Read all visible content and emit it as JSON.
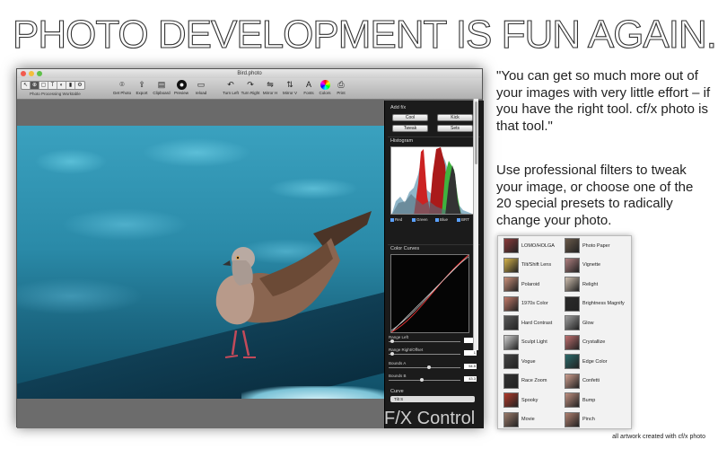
{
  "headline": "PHOTO DEVELOPMENT IS FUN AGAIN.",
  "window": {
    "title": "Bird.photo",
    "workspace_label": "Photo Processing Worktable",
    "toolbar": [
      {
        "label": "Get Photo",
        "icon": "camera-icon"
      },
      {
        "label": "Export",
        "icon": "export-icon"
      },
      {
        "label": "Clipboard",
        "icon": "clipboard-icon"
      },
      {
        "label": "Preview",
        "icon": "preview-icon"
      },
      {
        "label": "reload",
        "icon": "reload-icon"
      },
      {
        "label": "Turn Left",
        "icon": "rotate-left-icon"
      },
      {
        "label": "Turn Right",
        "icon": "rotate-right-icon"
      },
      {
        "label": "Mirror H",
        "icon": "mirror-h-icon"
      },
      {
        "label": "Mirror V",
        "icon": "mirror-v-icon"
      },
      {
        "label": "Fonts",
        "icon": "fonts-icon"
      },
      {
        "label": "Colors",
        "icon": "colors-icon"
      },
      {
        "label": "Print",
        "icon": "print-icon"
      }
    ],
    "mode_buttons": [
      "↖",
      "⊕",
      "▢",
      "T",
      "◐",
      "▮",
      "⚙"
    ]
  },
  "panel": {
    "add_fx": "Add f/x",
    "fx_buttons": [
      "Cool",
      "Kick",
      "Tweak",
      "Sets"
    ],
    "histogram_title": "Histogram",
    "histogram_channels": [
      "Red",
      "Green",
      "Blue",
      "BRT"
    ],
    "curves_title": "Color Curves",
    "sliders": [
      {
        "label": "Range Left",
        "value": "1",
        "level": 0.03
      },
      {
        "label": "Range Right/Offset",
        "value": "1",
        "level": 0.03
      },
      {
        "label": "Bounds A",
        "value": "54.5",
        "level": 0.55
      },
      {
        "label": "Bounds B",
        "value": "43.3",
        "level": 0.45
      }
    ],
    "curve_label": "Curve",
    "curve_value": "Tilt S",
    "brand": "F/X Control"
  },
  "quote": "\"You can get so much more out of your images with very little effort – if you have the right tool. cf/x photo is that tool.\"",
  "paragraph": "Use professional filters to tweak your image, or choose one of the 20 special presets to radically change your photo.",
  "presets_left": [
    "LOMO/HOLGA",
    "Tilt/Shift Lens",
    "Polaroid",
    "1970s Color",
    "Hard Contrast",
    "Sculpt Light",
    "Vogue",
    "Race Zoom",
    "Spooky",
    "Movie"
  ],
  "presets_right": [
    "Photo Paper",
    "Vignette",
    "Relight",
    "Brightness Magnify",
    "Glow",
    "Crystallize",
    "Edge Color",
    "Confetti",
    "Bump",
    "Pinch"
  ],
  "credit": "all artwork created with cf/x photo"
}
